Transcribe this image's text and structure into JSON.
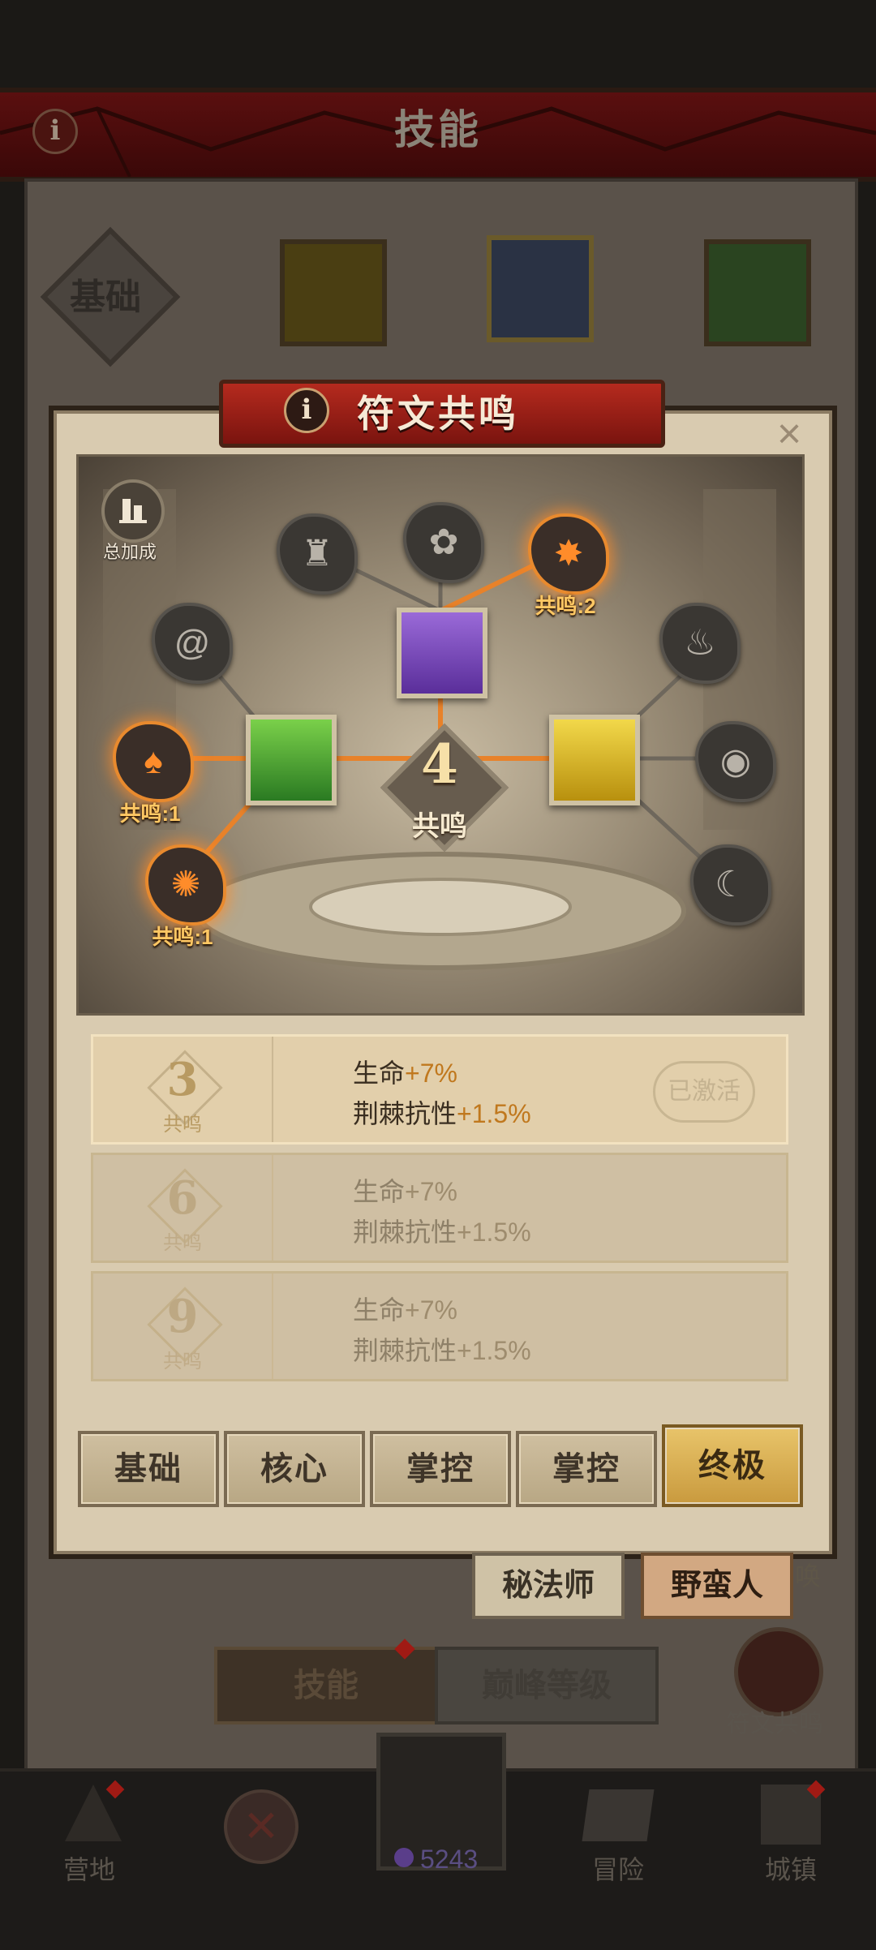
{
  "header": {
    "title": "技能"
  },
  "background": {
    "base_label": "基础",
    "class_buttons": [
      "秘法师",
      "野蛮人"
    ],
    "side_cut_label": "唤",
    "bottom_tabs": [
      "技能",
      "巅峰等级"
    ],
    "rune_shortcut_label": "符文共鸣",
    "nav": {
      "camp": "营地",
      "adventure": "冒险",
      "town": "城镇",
      "currency_value": "5243"
    }
  },
  "modal": {
    "title": "符文共鸣",
    "close_symbol": "×",
    "info_symbol": "i",
    "total_bonus_label": "总加成",
    "center": {
      "value": "4",
      "label": "共鸣"
    },
    "rune_labels": {
      "top_right": "共鸣:2",
      "left": "共鸣:1",
      "bottom_left": "共鸣:1"
    },
    "tiers": [
      {
        "level": "3",
        "label": "共鸣",
        "line1_name": "生命",
        "line1_value": "+7%",
        "line2_name": "荆棘抗性",
        "line2_value": "+1.5%",
        "status": "已激活"
      },
      {
        "level": "6",
        "label": "共鸣",
        "line1_name": "生命",
        "line1_value": "+7%",
        "line2_name": "荆棘抗性",
        "line2_value": "+1.5%"
      },
      {
        "level": "9",
        "label": "共鸣",
        "line1_name": "生命",
        "line1_value": "+7%",
        "line2_name": "荆棘抗性",
        "line2_value": "+1.5%"
      }
    ],
    "tabs": [
      "基础",
      "核心",
      "掌控",
      "掌控",
      "终极"
    ],
    "selected_tab_index": 4
  },
  "colors": {
    "accent_orange": "#ff8c2a",
    "banner_red": "#b52a1e",
    "selected_gold": "#e8c46a"
  },
  "icons": {
    "info": "info-icon",
    "close": "close-icon",
    "bonus": "bar-chart-icon"
  }
}
